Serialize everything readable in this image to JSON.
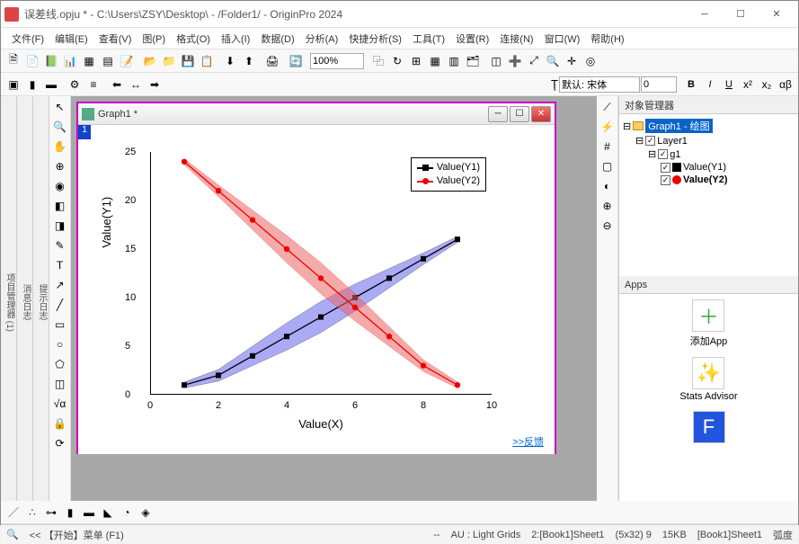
{
  "window": {
    "title": "误差线.opju * - C:\\Users\\ZSY\\Desktop\\ - /Folder1/ - OriginPro 2024"
  },
  "menu": {
    "file": "文件(F)",
    "edit": "编辑(E)",
    "view": "查看(V)",
    "plot": "图(P)",
    "format": "格式(O)",
    "insert": "插入(I)",
    "data": "数据(D)",
    "analysis": "分析(A)",
    "gadgets": "快捷分析(S)",
    "tools": "工具(T)",
    "preferences": "设置(R)",
    "connect": "连接(N)",
    "window": "窗口(W)",
    "help": "帮助(H)"
  },
  "toolbar": {
    "zoom": "100%",
    "font_label": "默认: 宋体",
    "size": "0"
  },
  "sidebar_tabs": {
    "project": "项目管理器 (1)",
    "messages": "消息日志",
    "hints": "提示日志"
  },
  "graph": {
    "title": "Graph1 *",
    "page_no": "1",
    "xlabel": "Value(X)",
    "ylabel": "Value(Y1)",
    "legend": {
      "s1": "Value(Y1)",
      "s2": "Value(Y2)"
    },
    "feedback": ">>反馈"
  },
  "object_manager": {
    "title": "对象管理器",
    "root": "Graph1 - 绘图",
    "layer": "Layer1",
    "group": "g1",
    "s1": "Value(Y1)",
    "s2": "Value(Y2)"
  },
  "apps": {
    "title": "Apps",
    "add": "添加App",
    "stats": "Stats Advisor"
  },
  "statusbar": {
    "hint": "<<  【开始】菜单 (F1)",
    "au": "AU : Light Grids",
    "sheet": "2:[Book1]Sheet1",
    "coord": "(5x32) 9",
    "size": "15KB",
    "path": "[Book1]Sheet1",
    "unit": "弧度"
  },
  "chart_data": {
    "type": "line",
    "xlabel": "Value(X)",
    "ylabel": "Value(Y1)",
    "xlim": [
      0,
      10
    ],
    "ylim": [
      0,
      25
    ],
    "xticks": [
      0,
      2,
      4,
      6,
      8,
      10
    ],
    "yticks": [
      0,
      5,
      10,
      15,
      20,
      25
    ],
    "x": [
      1,
      2,
      3,
      4,
      5,
      6,
      7,
      8,
      9
    ],
    "series": [
      {
        "name": "Value(Y1)",
        "color": "#000000",
        "band_fill": "#6666ee",
        "values": [
          1,
          2,
          4,
          6,
          8,
          10,
          12,
          14,
          16
        ],
        "err": [
          0.3,
          0.6,
          1.0,
          1.4,
          1.6,
          1.4,
          1.0,
          0.6,
          0.3
        ]
      },
      {
        "name": "Value(Y2)",
        "color": "#ee0000",
        "band_fill": "#ee6666",
        "values": [
          24,
          21,
          18,
          15,
          12,
          9,
          6,
          3,
          1
        ],
        "err": [
          0.3,
          0.6,
          1.0,
          1.4,
          1.6,
          1.4,
          1.0,
          0.6,
          0.3
        ]
      }
    ]
  }
}
